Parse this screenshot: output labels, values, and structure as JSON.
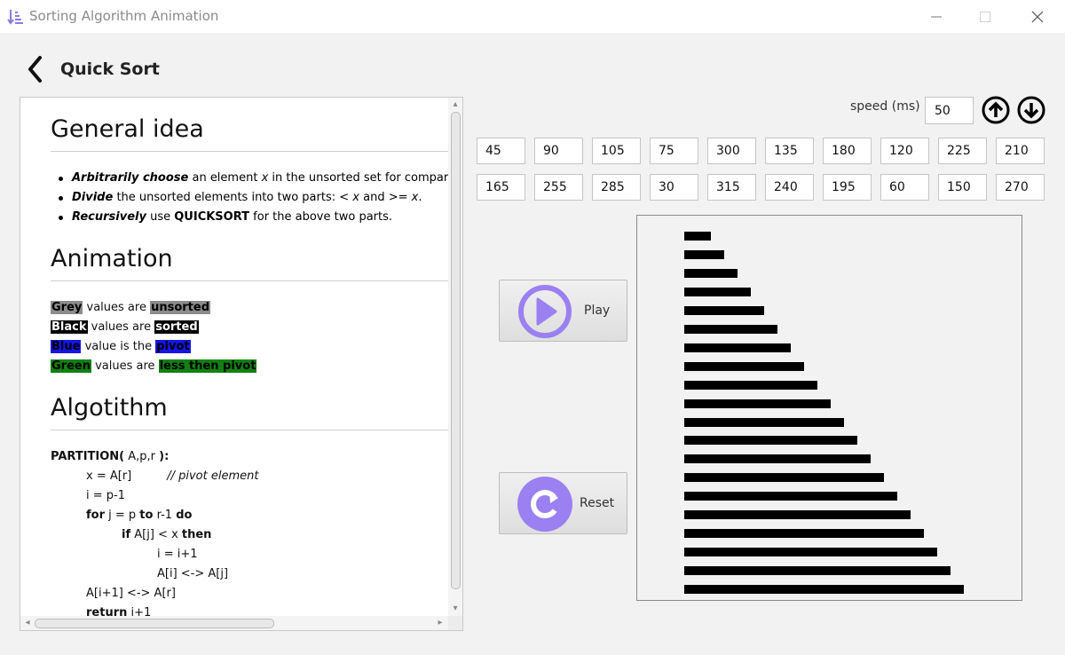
{
  "window": {
    "title": "Sorting Algorithm Animation",
    "icon": "sort-descending-icon",
    "controls": [
      "minimize-icon",
      "maximize-icon",
      "close-icon"
    ]
  },
  "header": {
    "back_icon": "chevron-left-icon",
    "title": "Quick Sort"
  },
  "doc": {
    "general": {
      "heading": "General idea",
      "bullets": [
        {
          "lead": "Arbitrarily choose",
          "text1": " an element ",
          "var": "x",
          "text2": " in the unsorted set for comparison"
        },
        {
          "lead": "Divide",
          "text1": " the unsorted elements into two parts: < ",
          "var": "x",
          "text2": " and >= ",
          "var2": "x",
          "text3": "."
        },
        {
          "lead": "Recursively",
          "text1": " use ",
          "kw": "QUICKSORT",
          "text2": " for the above two parts."
        }
      ]
    },
    "animation": {
      "heading": "Animation",
      "legend": [
        {
          "color_word": "Grey",
          "middle": " values are ",
          "state": "unsorted"
        },
        {
          "color_word": "Black",
          "middle": " values are ",
          "state": "sorted"
        },
        {
          "color_word": "Blue",
          "middle": " value is the ",
          "state": "pivot"
        },
        {
          "color_word": "Green",
          "middle": " values are ",
          "state": "less then pivot"
        }
      ]
    },
    "algorithm": {
      "heading": "Algotithm",
      "partition_kw": "PARTITION(",
      "partition_args": " A,p,r ",
      "partition_close": "):",
      "l1": "x = A[r]",
      "l1_comment": "// pivot element",
      "l2": "i = p-1",
      "l3_for": "for",
      "l3_mid": " j = p ",
      "l3_to": "to",
      "l3_end": " r-1 ",
      "l3_do": "do",
      "l4_if": "if",
      "l4_mid": " A[j] < x ",
      "l4_then": "then",
      "l5": "i = i+1",
      "l6": "A[i] <-> A[j]",
      "l7": "A[i+1] <-> A[r]",
      "l8_return": "return",
      "l8_val": " i+1"
    }
  },
  "controls": {
    "speed_label": "speed (ms)",
    "speed_value": "50",
    "speed_up_icon": "arrow-up-circle-icon",
    "speed_down_icon": "arrow-down-circle-icon",
    "values_row1": [
      "45",
      "90",
      "105",
      "75",
      "300",
      "135",
      "180",
      "120",
      "225",
      "210"
    ],
    "values_row2": [
      "165",
      "255",
      "285",
      "30",
      "315",
      "240",
      "195",
      "60",
      "150",
      "270"
    ],
    "play_label": "Play",
    "play_icon": "play-icon",
    "reset_label": "Reset",
    "reset_icon": "reset-icon",
    "accent_color": "#9a80f0"
  },
  "chart_data": {
    "type": "bar",
    "orientation": "horizontal",
    "state": "sorted",
    "bar_color": "#000000",
    "values": [
      30,
      45,
      60,
      75,
      90,
      105,
      120,
      135,
      150,
      165,
      180,
      195,
      210,
      225,
      240,
      255,
      270,
      285,
      300,
      315
    ],
    "xlim": [
      0,
      315
    ]
  }
}
